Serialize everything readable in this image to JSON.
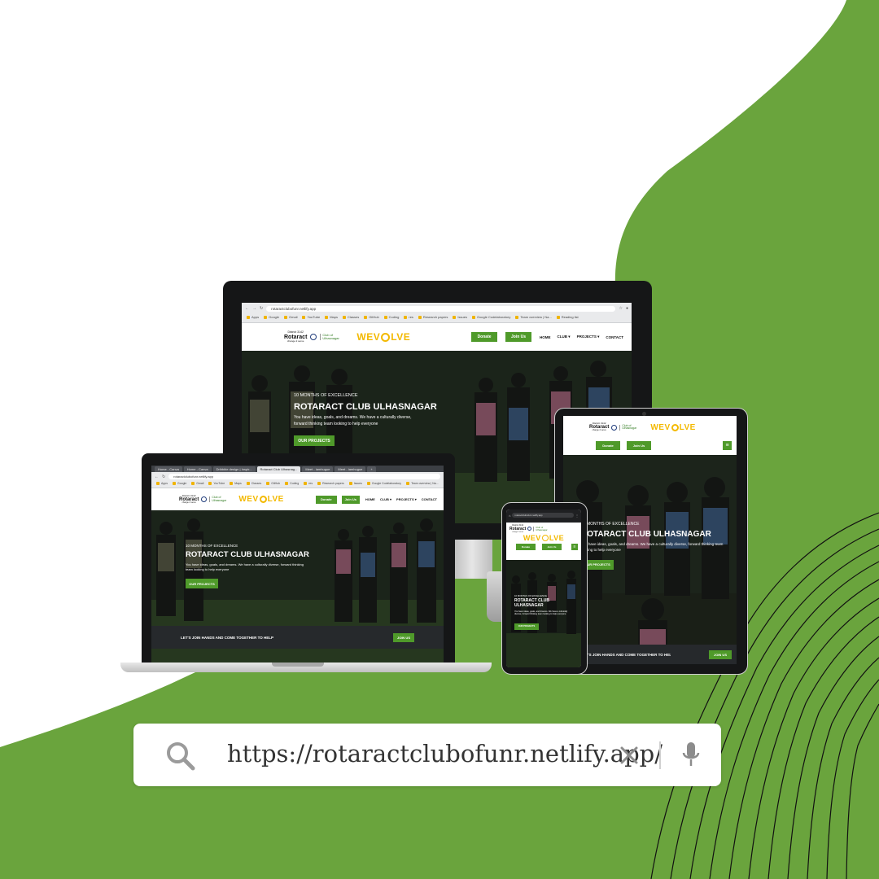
{
  "colors": {
    "green": "#6aa43d",
    "button_green": "#4f9a2a",
    "dark": "#151617",
    "line": "#111111",
    "logo_yellow": "#f3b900"
  },
  "search": {
    "url": "https://rotaractclubofunr.netlify.app/",
    "icons": [
      "search-icon",
      "close-icon",
      "microphone-icon"
    ]
  },
  "site": {
    "address": "rotaractclubofunr.netlify.app",
    "logo": {
      "district": "District 3142",
      "name": "Rotaract",
      "tagline": "change 2 serve",
      "club": "Club of Ulhasnagar",
      "wevolve": "WEVOLVE"
    },
    "donate_label": "Donate",
    "join_label": "Join Us",
    "nav": [
      "HOME",
      "CLUB ▾",
      "PROJECTS ▾",
      "CONTACT"
    ],
    "hero_tag": "10 MONTHS OF EXCELLENCE",
    "hero_title": "ROTARACT CLUB ULHASNAGAR",
    "hero_desc": "You have ideas, goals, and dreams. We have a culturally diverse, forward thinking team looking to help everyone",
    "hero_button": "OUR PROJECTS",
    "strip_text": "LET'S JOIN HANDS AND COME TOGETHER TO HELP",
    "strip_button": "JOIN US"
  },
  "desktop_browser": {
    "bookmarks": [
      "Apps",
      "Google",
      "Gmail",
      "YouTube",
      "Maps",
      "Classes",
      "GitHub",
      "Coding",
      "res",
      "Research papers",
      "Issues",
      "Google Codelaboratory",
      "Team overview | Na...",
      "Reading list"
    ]
  },
  "laptop_browser": {
    "tabs": [
      "Home - Canva",
      "Home - Canva",
      "Dribbble design | Inspir...",
      "Rotaract Club Ulhasnag...",
      "Meet - iamhugue",
      "Meet - iamhugue"
    ],
    "address": "rotaractclubofunr.netlify.app",
    "bookmarks": [
      "Apps",
      "Google",
      "Gmail",
      "YouTube",
      "Maps",
      "Classes",
      "GitHub",
      "Coding",
      "res",
      "Research papers",
      "Issues",
      "Google Codelaboratory",
      "Team overview | Na..."
    ]
  }
}
